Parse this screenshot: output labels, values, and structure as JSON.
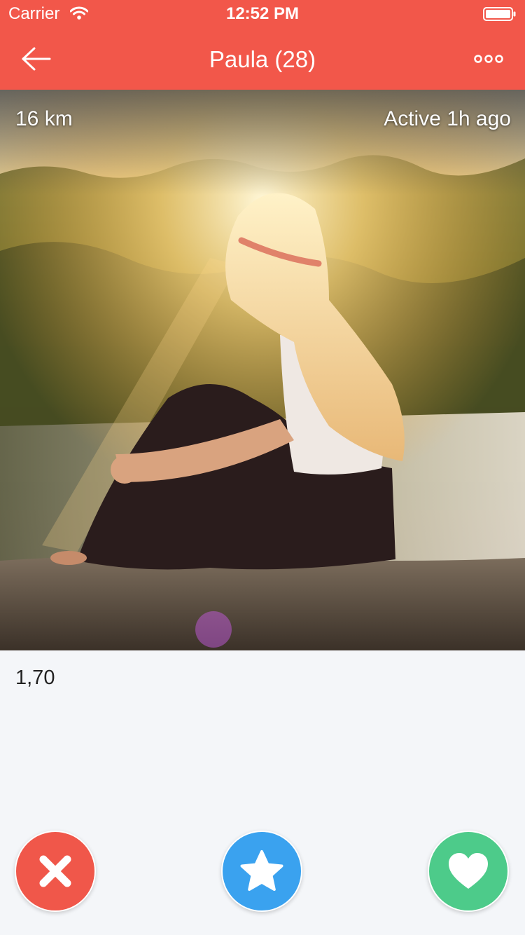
{
  "status_bar": {
    "carrier": "Carrier",
    "time": "12:52 PM",
    "wifi_icon": "wifi-icon",
    "battery_icon": "battery-icon"
  },
  "nav_bar": {
    "title": "Paula (28)",
    "back_icon": "arrow-left-icon",
    "more_icon": "more-dots-icon"
  },
  "photo": {
    "distance": "16 km",
    "last_active": "Active 1h ago"
  },
  "profile": {
    "height": "1,70"
  },
  "actions": [
    {
      "name": "dislike",
      "icon": "close-icon",
      "color": "#f0574a"
    },
    {
      "name": "superlike",
      "icon": "star-icon",
      "color": "#3aa2ef"
    },
    {
      "name": "like",
      "icon": "heart-icon",
      "color": "#4dcb8a"
    }
  ],
  "colors": {
    "accent": "#f2574a",
    "background": "#f4f6f9"
  }
}
